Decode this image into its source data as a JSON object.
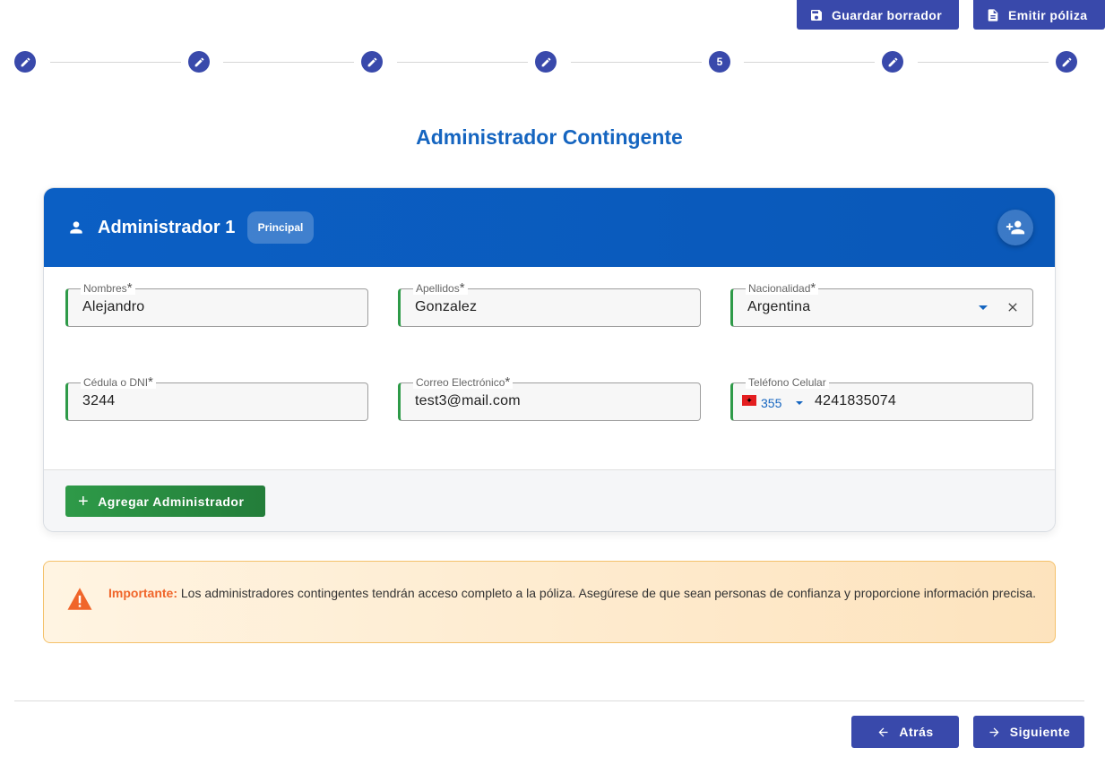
{
  "toolbar": {
    "save_draft_label": "Guardar borrador",
    "issue_policy_label": "Emitir póliza"
  },
  "stepper": {
    "steps": [
      {
        "state": "edit",
        "label": ""
      },
      {
        "state": "edit",
        "label": ""
      },
      {
        "state": "edit",
        "label": ""
      },
      {
        "state": "edit",
        "label": ""
      },
      {
        "state": "current",
        "label": "5"
      },
      {
        "state": "edit",
        "label": ""
      },
      {
        "state": "edit",
        "label": ""
      }
    ]
  },
  "page": {
    "title": "Administrador Contingente"
  },
  "admin_card": {
    "title": "Administrador 1",
    "badge": "Principal",
    "fields": {
      "nombres": {
        "label": "Nombres",
        "required": "*",
        "value": "Alejandro"
      },
      "apellidos": {
        "label": "Apellidos",
        "required": "*",
        "value": "Gonzalez"
      },
      "nacionalidad": {
        "label": "Nacionalidad",
        "required": "*",
        "value": "Argentina"
      },
      "cedula": {
        "label": "Cédula o DNI",
        "required": "*",
        "value": "3244"
      },
      "correo": {
        "label": "Correo Electrónico",
        "required": "*",
        "value": "test3@mail.com"
      },
      "telefono": {
        "label": "Teléfono Celular",
        "country_flag": "albania-flag",
        "country_code": "355",
        "value": "4241835074"
      }
    },
    "add_admin_label": "Agregar Administrador"
  },
  "alert": {
    "strong": "Importante:",
    "text": " Los administradores contingentes tendrán acceso completo a la póliza. Asegúrese de que sean personas de confianza y proporcione información precisa."
  },
  "nav": {
    "back_label": "Atrás",
    "next_label": "Siguiente"
  },
  "colors": {
    "primary": "#3949ab",
    "header_blue": "#0b5fc4",
    "success_green": "#2e9a48",
    "warning_orange": "#f0652a"
  }
}
